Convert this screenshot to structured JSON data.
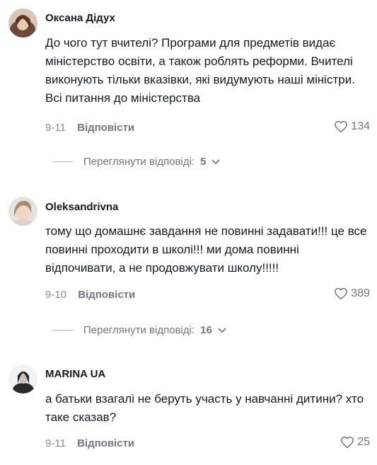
{
  "comments": [
    {
      "username": "Оксана Дідух",
      "text": "До чого тут вчителі? Програми для предметів видає міністерство освіти, а також роблять реформи. Вчителі виконують тільки вказівки, які видумують наші міністри. Всі питання до міністерства",
      "date": "9-11",
      "reply_label": "Відповісти",
      "likes": "134",
      "view_replies": {
        "label": "Переглянути відповіді:",
        "count": "5"
      }
    },
    {
      "username": "Oleksandrivna",
      "text": "тому що домашнє завдання не повинні задавати!!! це все повинні проходити в школі!!! ми дома повинні відпочивати, а не продовжувати школу!!!!!",
      "date": "9-10",
      "reply_label": "Відповісти",
      "likes": "389",
      "view_replies": {
        "label": "Переглянути відповіді:",
        "count": "16"
      }
    },
    {
      "username": "MARINA UA",
      "text": "а батьки взагалі не беруть участь у навчанні дитини? хто таке сказав?",
      "date": "9-11",
      "reply_label": "Відповісти",
      "likes": "25"
    }
  ],
  "colors": {
    "text": "#161823",
    "secondary": "#737480",
    "muted": "#8a8b91"
  }
}
